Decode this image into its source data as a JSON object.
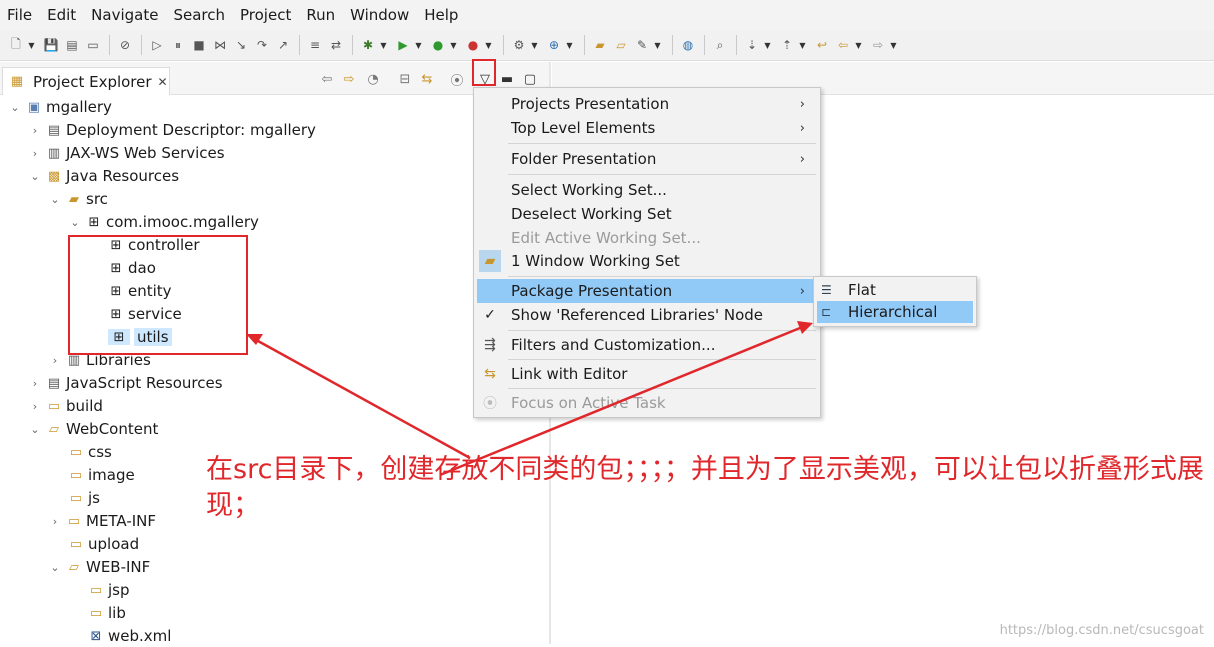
{
  "menubar": [
    "File",
    "Edit",
    "Navigate",
    "Search",
    "Project",
    "Run",
    "Window",
    "Help"
  ],
  "view_tab": {
    "title": "Project Explorer",
    "close": "✕"
  },
  "tree": [
    {
      "label": "mgallery",
      "icon": "project-icon",
      "twisty": "⌄"
    },
    {
      "label": "Deployment Descriptor: mgallery",
      "icon": "descriptor-icon",
      "twisty": "›"
    },
    {
      "label": "JAX-WS Web Services",
      "icon": "webservice-icon",
      "twisty": "›"
    },
    {
      "label": "Java Resources",
      "icon": "java-resources-icon",
      "twisty": "⌄"
    },
    {
      "label": "src",
      "icon": "source-folder-icon",
      "twisty": "⌄"
    },
    {
      "label": "com.imooc.mgallery",
      "icon": "package-icon",
      "twisty": "⌄"
    },
    {
      "label": "controller",
      "icon": "package-icon",
      "twisty": ""
    },
    {
      "label": "dao",
      "icon": "package-icon",
      "twisty": ""
    },
    {
      "label": "entity",
      "icon": "package-icon",
      "twisty": ""
    },
    {
      "label": "service",
      "icon": "package-icon",
      "twisty": ""
    },
    {
      "label": "utils",
      "icon": "package-icon",
      "twisty": ""
    },
    {
      "label": "Libraries",
      "icon": "library-icon",
      "twisty": "›"
    },
    {
      "label": "JavaScript Resources",
      "icon": "js-resources-icon",
      "twisty": "›"
    },
    {
      "label": "build",
      "icon": "folder-icon",
      "twisty": "›"
    },
    {
      "label": "WebContent",
      "icon": "folder-open-icon",
      "twisty": "⌄"
    },
    {
      "label": "css",
      "icon": "folder-icon",
      "twisty": ""
    },
    {
      "label": "image",
      "icon": "folder-icon",
      "twisty": ""
    },
    {
      "label": "js",
      "icon": "folder-icon",
      "twisty": ""
    },
    {
      "label": "META-INF",
      "icon": "folder-icon",
      "twisty": "›"
    },
    {
      "label": "upload",
      "icon": "folder-icon",
      "twisty": ""
    },
    {
      "label": "WEB-INF",
      "icon": "folder-open-icon",
      "twisty": "⌄"
    },
    {
      "label": "jsp",
      "icon": "folder-icon",
      "twisty": ""
    },
    {
      "label": "lib",
      "icon": "folder-icon",
      "twisty": ""
    },
    {
      "label": "web.xml",
      "icon": "xml-file-icon",
      "twisty": ""
    }
  ],
  "view_menu": [
    {
      "label": "Projects Presentation",
      "submenu": "›"
    },
    {
      "label": "Top Level Elements",
      "submenu": "›"
    },
    {
      "label": "Folder Presentation",
      "submenu": "›"
    },
    {
      "label": "Select Working Set..."
    },
    {
      "label": "Deselect Working Set"
    },
    {
      "label": "Edit Active Working Set..."
    },
    {
      "label": "1 Window Working Set"
    },
    {
      "label": "Package Presentation",
      "submenu": "›"
    },
    {
      "label": "Show 'Referenced Libraries' Node",
      "check": "✓"
    },
    {
      "label": "Filters and Customization..."
    },
    {
      "label": "Link with Editor"
    },
    {
      "label": "Focus on Active Task"
    }
  ],
  "package_submenu": [
    {
      "label": "Flat"
    },
    {
      "label": "Hierarchical"
    }
  ],
  "annotation": {
    "text": "在src目录下，创建存放不同类的包；；；；并且为了显示美观，可以让包以折叠形式展现；",
    "color": "#e0282c"
  },
  "watermark": "https://blog.csdn.net/csucsgoat",
  "colors": {
    "highlight": "#91c9f7",
    "annotation": "#e0282c",
    "selection": "#cde8ff"
  }
}
